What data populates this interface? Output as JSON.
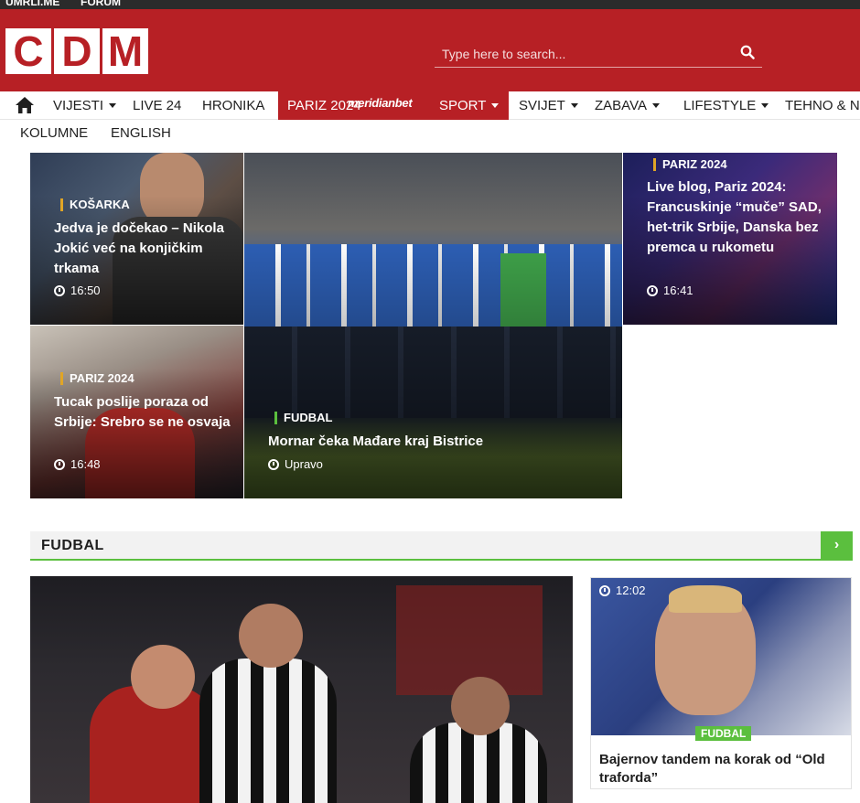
{
  "topbar": {
    "links": [
      "UMRLI.ME",
      "FORUM"
    ]
  },
  "logo": {
    "letters": [
      "C",
      "D",
      "M"
    ]
  },
  "search": {
    "placeholder": "Type here to search..."
  },
  "nav": {
    "items": [
      "VIJESTI",
      "LIVE 24",
      "HRONIKA",
      "PARIZ 2024",
      "SPORT",
      "SVIJET",
      "ZABAVA",
      "LIFESTYLE",
      "TEHNO & N"
    ],
    "sponsor": "meridianbet",
    "sub_items": [
      "KOLUMNE",
      "ENGLISH"
    ],
    "accent": "#b72025"
  },
  "hero": {
    "articles": [
      {
        "category": "KOŠARKA",
        "title": "Jedva je dočekao – Nikola Jokić već na konjičkim trkama",
        "time": "16:50"
      },
      {
        "category": "PARIZ 2024",
        "title": "Tucak poslije poraza od Srbije: Srebro se ne osvaja",
        "time": "16:48"
      },
      {
        "category": "FUDBAL",
        "title": "Mornar čeka Mađare kraj Bistrice",
        "time": "Upravo"
      },
      {
        "category": "PARIZ 2024",
        "title": "Live blog, Pariz 2024: Francuskinje “muče” SAD, het-trik Srbije, Danska bez premca u rukometu",
        "time": "16:41"
      }
    ]
  },
  "section": {
    "title": "FUDBAL",
    "more": "›",
    "accent": "#5bbf3e",
    "card": {
      "time": "12:02",
      "category": "FUDBAL",
      "title": "Bajernov tandem na korak od “Old traforda”"
    }
  }
}
